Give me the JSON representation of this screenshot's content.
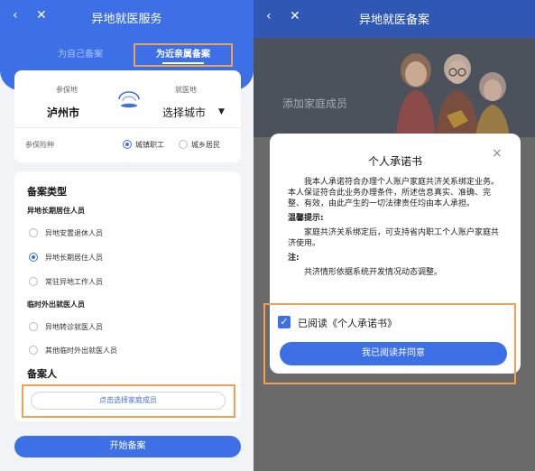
{
  "left": {
    "nav": {
      "back_icon": "‹",
      "close_icon": "✕",
      "title": "异地就医服务"
    },
    "tabs": {
      "self": "为自己备案",
      "relative": "为近亲属备案"
    },
    "location": {
      "insured_label": "参保地",
      "insured_value": "泸州市",
      "treat_label": "就医地",
      "treat_value": "选择城市",
      "caret": "▼"
    },
    "insurance": {
      "label": "参保险种",
      "options": [
        "城镇职工",
        "城乡居民"
      ],
      "selected": "城镇职工"
    },
    "filing": {
      "section_title": "备案类型",
      "group1_title": "异地长期居住人员",
      "group1_items": [
        "异地安置退休人员",
        "异地长期居住人员",
        "常驻异地工作人员"
      ],
      "group1_selected": "异地长期居住人员",
      "group2_title": "临时外出就医人员",
      "group2_items": [
        "异地转诊就医人员",
        "其他临时外出就医人员"
      ]
    },
    "filer": {
      "section_title": "备案人",
      "choose_label": "点击选择家庭成员"
    },
    "start_label": "开始备案",
    "colors": {
      "primary": "#3d6fe6",
      "highlight": "#f0a050"
    }
  },
  "right": {
    "nav": {
      "back_icon": "‹",
      "close_icon": "✕",
      "title": "异地就医备案"
    },
    "banner_text": "添加家庭成员",
    "modal": {
      "title": "个人承诺书",
      "close_icon": "×",
      "para1": "我本人承诺符合办理个人账户家庭共济关系绑定业务。本人保证符合此业务办理条件，所述信息真实、准确、完整、有效，由此产生的一切法律责任均由本人承担。",
      "tip_title": "温馨提示:",
      "tip_text": "家庭共济关系绑定后，可支持省内职工个人账户家庭共济使用。",
      "note_title": "注:",
      "note_text": "共济情形依据系统开发情况动态调整。",
      "agree_check": "✓",
      "agree_label": "已阅读《个人承诺书》",
      "confirm_label": "我已阅读并同意"
    }
  }
}
